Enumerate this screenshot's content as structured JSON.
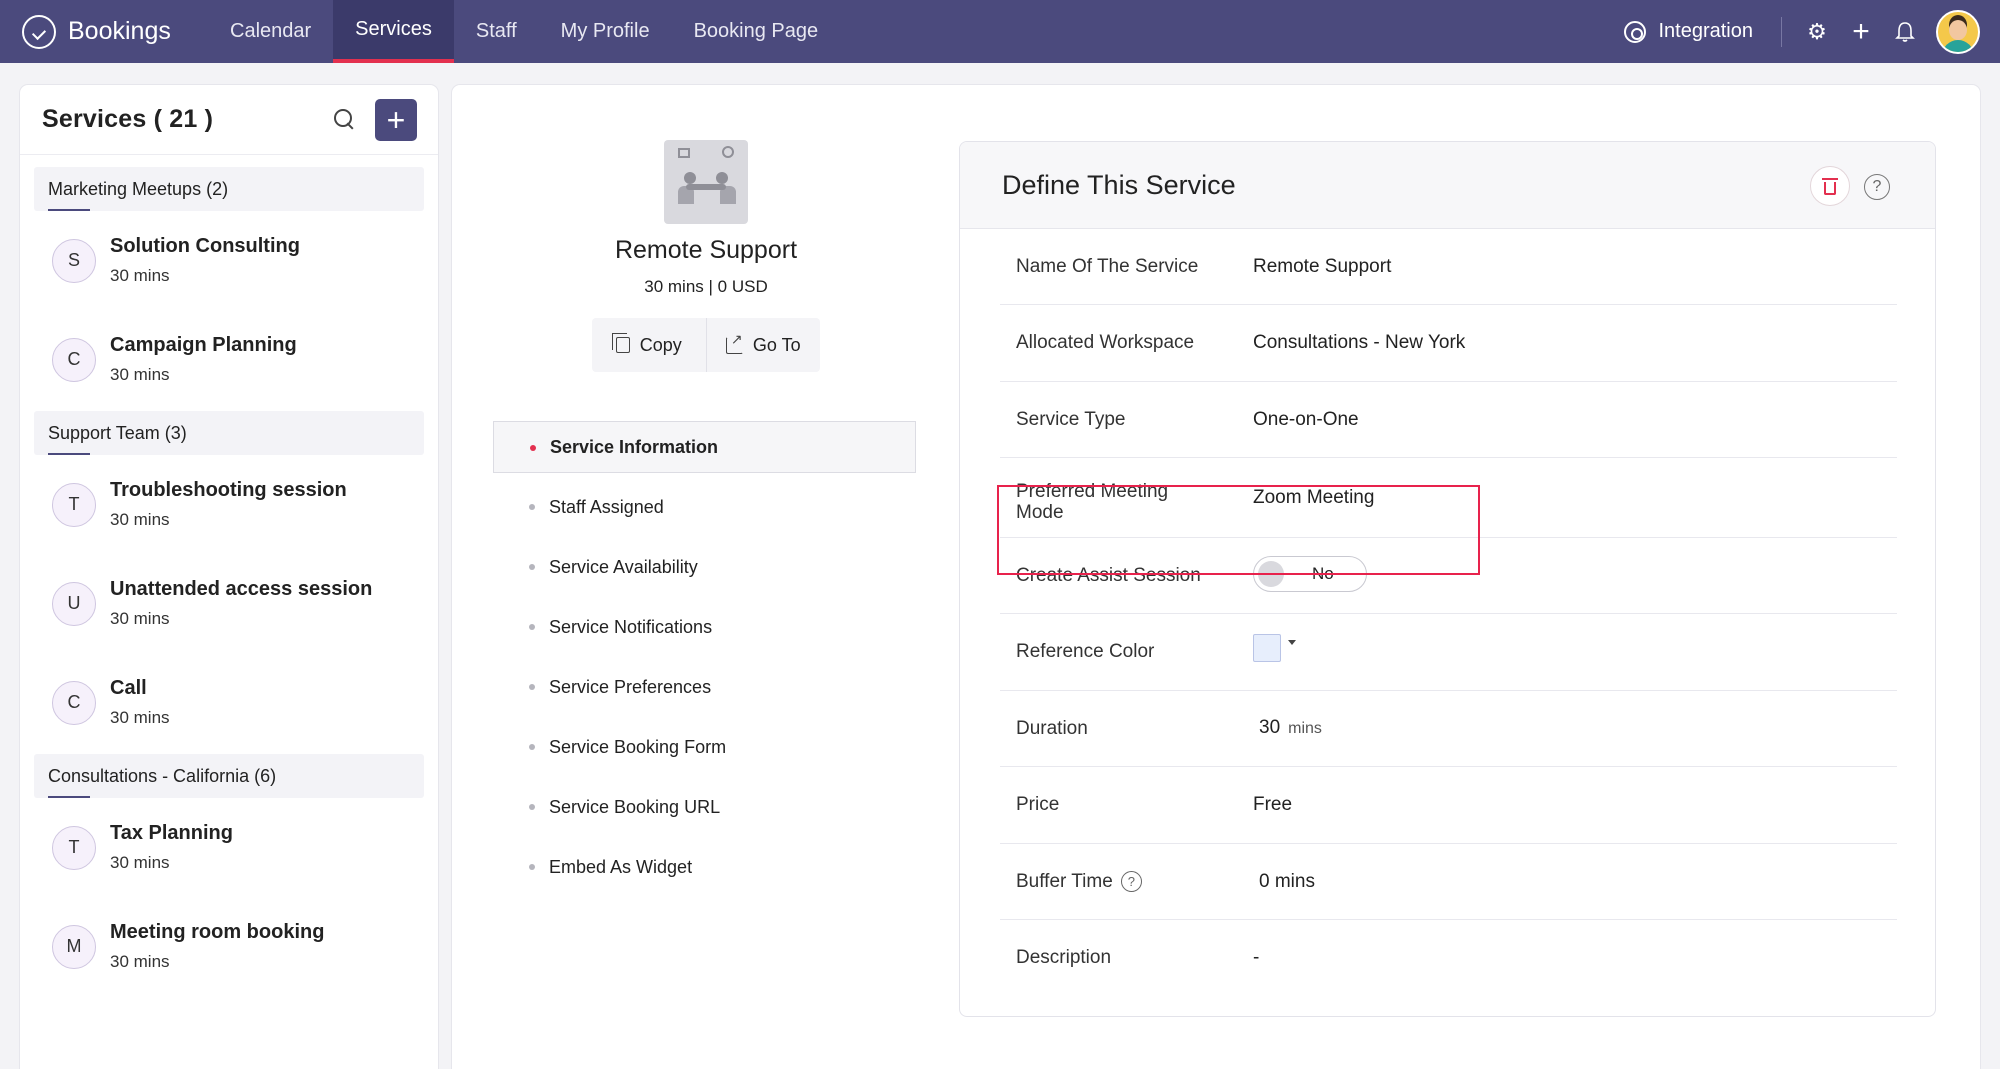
{
  "app": {
    "name": "Bookings"
  },
  "nav": {
    "items": [
      {
        "label": "Calendar"
      },
      {
        "label": "Services"
      },
      {
        "label": "Staff"
      },
      {
        "label": "My Profile"
      },
      {
        "label": "Booking Page"
      }
    ],
    "integration_label": "Integration"
  },
  "services_panel": {
    "title": "Services ( 21 )",
    "add_label": "+",
    "groups": [
      {
        "name": "Marketing Meetups (2)",
        "items": [
          {
            "initial": "S",
            "name": "Solution Consulting",
            "duration": "30 mins"
          },
          {
            "initial": "C",
            "name": "Campaign Planning",
            "duration": "30 mins"
          }
        ]
      },
      {
        "name": "Support Team (3)",
        "items": [
          {
            "initial": "T",
            "name": "Troubleshooting session",
            "duration": "30 mins"
          },
          {
            "initial": "U",
            "name": "Unattended access session",
            "duration": "30 mins"
          },
          {
            "initial": "C",
            "name": "Call",
            "duration": "30 mins"
          }
        ]
      },
      {
        "name": "Consultations - California (6)",
        "items": [
          {
            "initial": "T",
            "name": "Tax Planning",
            "duration": "30 mins"
          },
          {
            "initial": "M",
            "name": "Meeting room booking",
            "duration": "30 mins"
          }
        ]
      }
    ]
  },
  "service_summary": {
    "name": "Remote Support",
    "meta": "30 mins | 0 USD",
    "copy_label": "Copy",
    "goto_label": "Go To"
  },
  "service_nav": [
    {
      "label": "Service Information"
    },
    {
      "label": "Staff Assigned"
    },
    {
      "label": "Service Availability"
    },
    {
      "label": "Service Notifications"
    },
    {
      "label": "Service Preferences"
    },
    {
      "label": "Service Booking Form"
    },
    {
      "label": "Service Booking URL"
    },
    {
      "label": "Embed As Widget"
    }
  ],
  "define": {
    "title": "Define This Service",
    "help_label": "?",
    "fields": {
      "name_label": "Name Of The Service",
      "name_value": "Remote Support",
      "workspace_label": "Allocated Workspace",
      "workspace_value": "Consultations - New York",
      "type_label": "Service Type",
      "type_value": "One-on-One",
      "mode_label_1": "Preferred Meeting",
      "mode_label_2": "Mode",
      "mode_value": "Zoom Meeting",
      "assist_label": "Create Assist Session",
      "assist_value": "No",
      "color_label": "Reference Color",
      "color_value": "#e7eefc",
      "duration_label": "Duration",
      "duration_value": "30",
      "duration_unit": "mins",
      "price_label": "Price",
      "price_value": "Free",
      "buffer_label": "Buffer Time",
      "buffer_value": "0 mins",
      "description_label": "Description",
      "description_value": "-"
    }
  }
}
